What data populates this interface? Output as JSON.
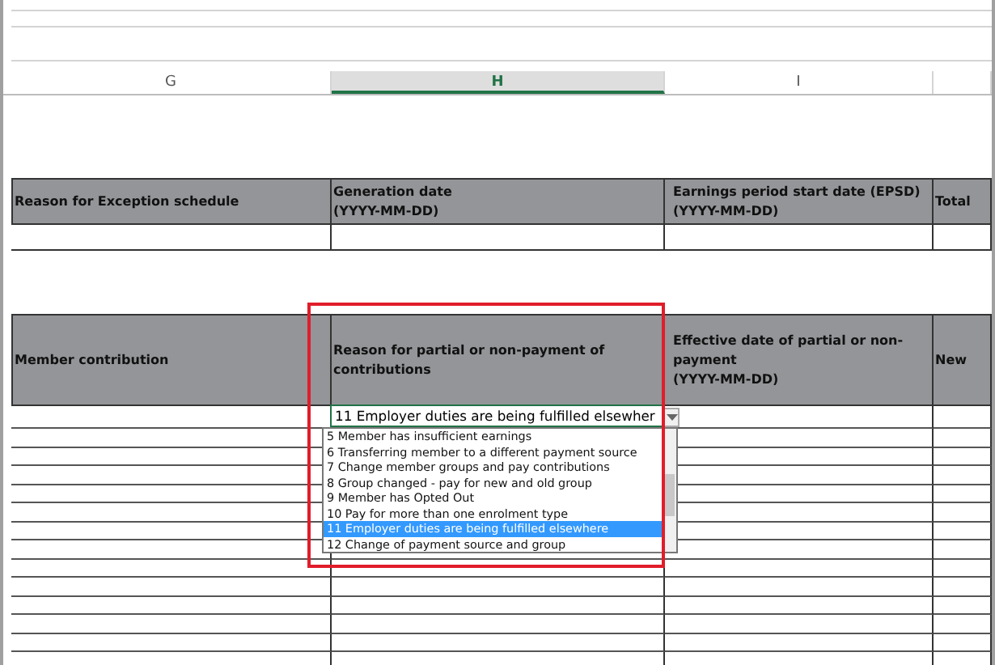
{
  "column_headers": [
    {
      "label": "G",
      "selected": false
    },
    {
      "label": "H",
      "selected": true
    },
    {
      "label": "I",
      "selected": false
    }
  ],
  "table_1": {
    "columns": [
      {
        "lines": [
          "Reason for Exception schedule"
        ]
      },
      {
        "lines": [
          "Generation date",
          "(YYYY-MM-DD)"
        ]
      },
      {
        "lines": [
          "Earnings period start date (EPSD)",
          "(YYYY-MM-DD)"
        ]
      },
      {
        "lines": [
          "Total"
        ]
      }
    ]
  },
  "table_2": {
    "columns": [
      {
        "lines": [
          "Member contribution"
        ]
      },
      {
        "lines": [
          "Reason for partial or non-payment of contributions"
        ]
      },
      {
        "lines": [
          "Effective date of partial or non-payment",
          "(YYYY-MM-DD)"
        ]
      },
      {
        "lines": [
          "New"
        ]
      }
    ],
    "cell_value": "11 Employer duties are being fulfilled elsewher",
    "highlighted": true,
    "dropdown": {
      "expanded": true,
      "options": [
        {
          "label": "5 Member has insufficient earnings",
          "selected": false
        },
        {
          "label": "6 Transferring member to a different payment source",
          "selected": false
        },
        {
          "label": "7  Change member groups and pay contributions",
          "selected": false
        },
        {
          "label": "8  Group changed - pay for new and old group",
          "selected": false
        },
        {
          "label": "9  Member has Opted Out",
          "selected": false
        },
        {
          "label": "10 Pay for more than one enrolment type",
          "selected": false
        },
        {
          "label": "11 Employer duties are being fulfilled elsewhere",
          "selected": true
        },
        {
          "label": "12 Change of payment source and group",
          "selected": false
        }
      ]
    }
  }
}
